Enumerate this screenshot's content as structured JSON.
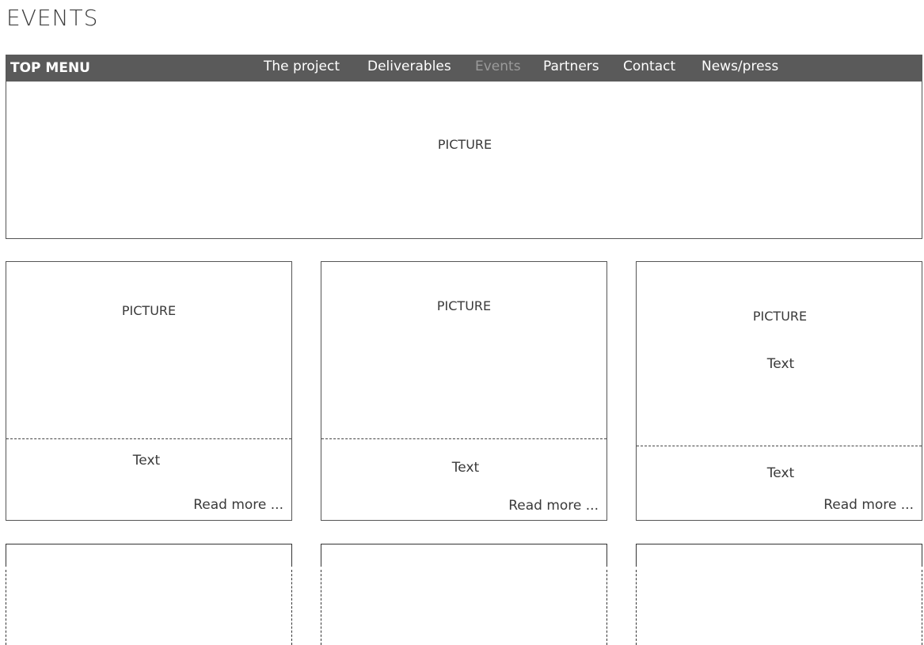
{
  "page": {
    "title": "EVENTS"
  },
  "top_menu": {
    "label": "TOP MENU",
    "items": [
      {
        "label": "The project",
        "active": false
      },
      {
        "label": "Deliverables",
        "active": false
      },
      {
        "label": "Events",
        "active": true
      },
      {
        "label": "Partners",
        "active": false
      },
      {
        "label": "Contact",
        "active": false
      },
      {
        "label": "News/press",
        "active": false
      }
    ]
  },
  "hero": {
    "picture_label": "PICTURE"
  },
  "cards": [
    {
      "picture_label": "PICTURE",
      "text": "Text",
      "read_more": "Read more ..."
    },
    {
      "picture_label": "PICTURE",
      "text": "Text",
      "read_more": "Read more ..."
    },
    {
      "picture_label": "PICTURE",
      "inner_text": "Text",
      "text": "Text",
      "read_more": "Read more ..."
    }
  ],
  "colors": {
    "menu_bar": "#5a5a5a",
    "menu_text": "#ffffff",
    "menu_active": "#9b9b9b",
    "border": "#555555"
  }
}
